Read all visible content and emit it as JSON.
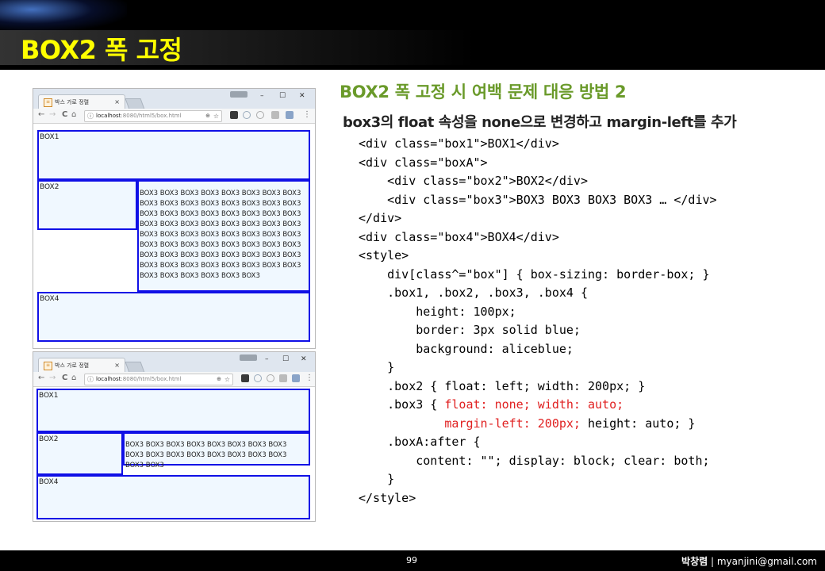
{
  "header": {
    "title": "BOX2 폭 고정"
  },
  "footer": {
    "page": "99",
    "author": "박창렴",
    "sep": "|",
    "email": "myanjini@gmail.com"
  },
  "browser": {
    "tab_title": "박스 가로 정렬",
    "tab_close": "×",
    "window_controls": [
      "–",
      "☐",
      "✕"
    ],
    "nav": {
      "back": "←",
      "forward": "→",
      "reload": "C",
      "home": "⌂"
    },
    "url_host": "localhost",
    "url_rest": ":8080/html5/box.html",
    "menu": "⋮"
  },
  "window1": {
    "box1": "BOX1",
    "box2": "BOX2",
    "box3": "BOX3 BOX3 BOX3 BOX3 BOX3 BOX3 BOX3 BOX3 BOX3 BOX3 BOX3 BOX3 BOX3 BOX3 BOX3 BOX3 BOX3 BOX3 BOX3 BOX3 BOX3 BOX3 BOX3 BOX3 BOX3 BOX3 BOX3 BOX3 BOX3 BOX3 BOX3 BOX3 BOX3 BOX3 BOX3 BOX3 BOX3 BOX3 BOX3 BOX3 BOX3 BOX3 BOX3 BOX3 BOX3 BOX3 BOX3 BOX3 BOX3 BOX3 BOX3 BOX3 BOX3 BOX3 BOX3 BOX3 BOX3 BOX3 BOX3 BOX3 BOX3 BOX3 BOX3 BOX3 BOX3 BOX3 BOX3 BOX3 BOX3 BOX3",
    "box4": "BOX4"
  },
  "window2": {
    "box1": "BOX1",
    "box2": "BOX2",
    "box3": "BOX3 BOX3 BOX3 BOX3 BOX3 BOX3 BOX3 BOX3 BOX3 BOX3 BOX3 BOX3 BOX3 BOX3 BOX3 BOX3 BOX3 BOX3",
    "box4": "BOX4"
  },
  "heading": "BOX2 폭 고정 시 여백 문제 대응 방법 2",
  "subheading": "box3의 float 속성을 none으로 변경하고 margin-left를 추가",
  "code": {
    "l1": "<div class=\"box1\">BOX1</div>",
    "l2": "<div class=\"boxA\">",
    "l3": "    <div class=\"box2\">BOX2</div>",
    "l4": "    <div class=\"box3\">BOX3 BOX3 BOX3 BOX3 … </div>",
    "l5": "</div>",
    "l6": "<div class=\"box4\">BOX4</div>",
    "l7": "<style>",
    "l8": "    div[class^=\"box\"] { box-sizing: border-box; }",
    "l9": "    .box1, .box2, .box3, .box4 {",
    "l10": "        height: 100px;",
    "l11": "        border: 3px solid blue;",
    "l12": "        background: aliceblue;",
    "l13": "    }",
    "l14": "    .box2 { float: left; width: 200px; }",
    "l15a": "    .box3 { ",
    "l15b": "float: none; width: auto;",
    "l16a": "            margin-left: 200px;",
    "l16b": " height: auto; }",
    "l17": "    .boxA:after {",
    "l18": "        content: \"\"; display: block; clear: both;",
    "l19": "    }",
    "l20": "</style>"
  }
}
